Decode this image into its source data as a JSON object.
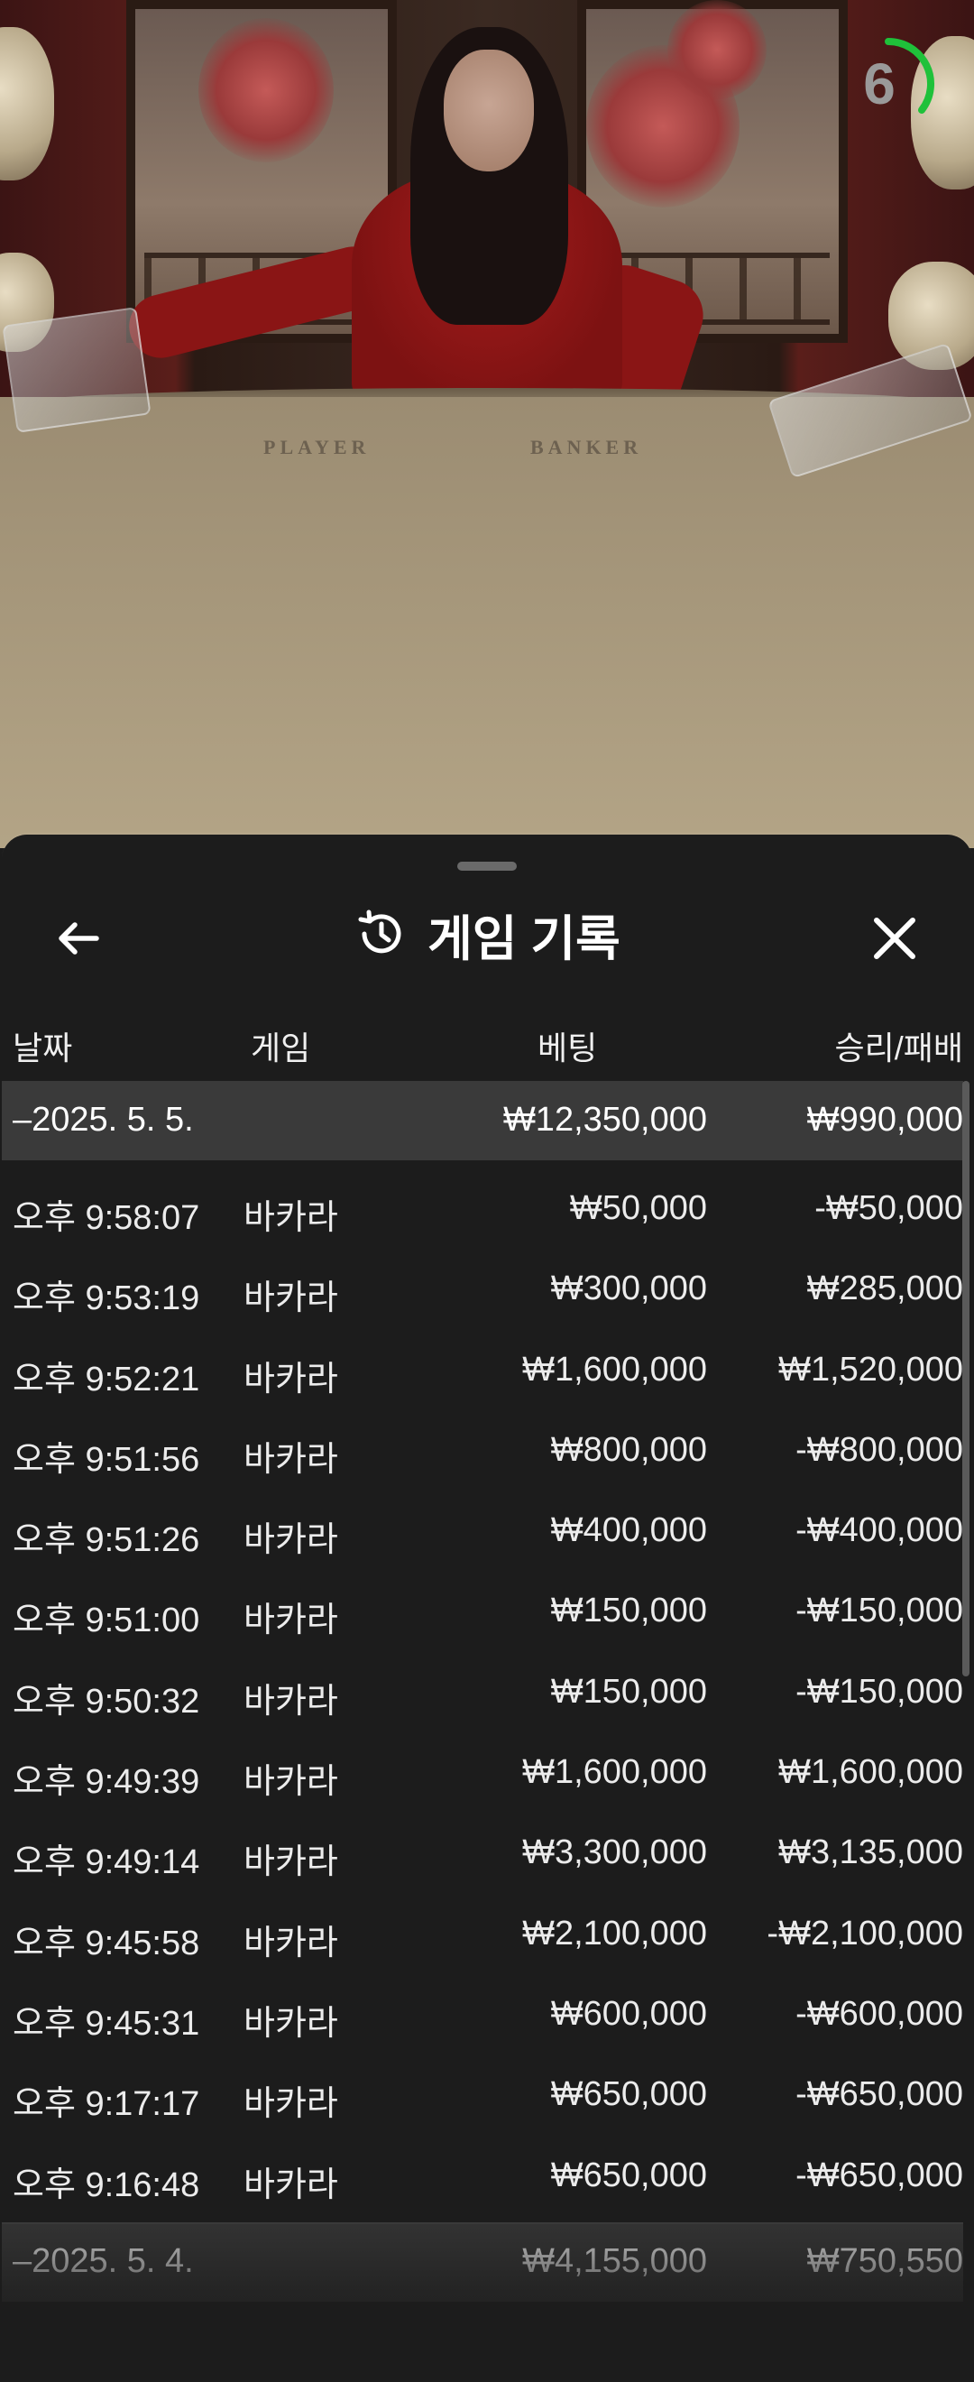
{
  "video": {
    "table_player_label": "PLAYER",
    "table_banker_label": "BANKER",
    "timer_value": "6",
    "timer_color": "#1fc13a"
  },
  "header": {
    "title": "게임 기록",
    "back_icon": "arrow-left-icon",
    "history_icon": "history-icon",
    "close_icon": "close-icon"
  },
  "columns": {
    "date": "날짜",
    "game": "게임",
    "bet": "베팅",
    "win_loss": "승리/패배"
  },
  "groups": [
    {
      "date": "–2025. 5. 5.",
      "bet_total": "₩12,350,000",
      "win_total": "₩990,000",
      "rows": [
        {
          "time": "오후 9:58:07",
          "game": "바카라",
          "bet": "₩50,000",
          "win": "-₩50,000"
        },
        {
          "time": "오후 9:53:19",
          "game": "바카라",
          "bet": "₩300,000",
          "win": "₩285,000"
        },
        {
          "time": "오후 9:52:21",
          "game": "바카라",
          "bet": "₩1,600,000",
          "win": "₩1,520,000"
        },
        {
          "time": "오후 9:51:56",
          "game": "바카라",
          "bet": "₩800,000",
          "win": "-₩800,000"
        },
        {
          "time": "오후 9:51:26",
          "game": "바카라",
          "bet": "₩400,000",
          "win": "-₩400,000"
        },
        {
          "time": "오후 9:51:00",
          "game": "바카라",
          "bet": "₩150,000",
          "win": "-₩150,000"
        },
        {
          "time": "오후 9:50:32",
          "game": "바카라",
          "bet": "₩150,000",
          "win": "-₩150,000"
        },
        {
          "time": "오후 9:49:39",
          "game": "바카라",
          "bet": "₩1,600,000",
          "win": "₩1,600,000"
        },
        {
          "time": "오후 9:49:14",
          "game": "바카라",
          "bet": "₩3,300,000",
          "win": "₩3,135,000"
        },
        {
          "time": "오후 9:45:58",
          "game": "바카라",
          "bet": "₩2,100,000",
          "win": "-₩2,100,000"
        },
        {
          "time": "오후 9:45:31",
          "game": "바카라",
          "bet": "₩600,000",
          "win": "-₩600,000"
        },
        {
          "time": "오후 9:17:17",
          "game": "바카라",
          "bet": "₩650,000",
          "win": "-₩650,000"
        },
        {
          "time": "오후 9:16:48",
          "game": "바카라",
          "bet": "₩650,000",
          "win": "-₩650,000"
        }
      ]
    },
    {
      "date": "–2025. 5. 4.",
      "bet_total": "₩4,155,000",
      "win_total": "₩750,550",
      "rows": []
    }
  ]
}
